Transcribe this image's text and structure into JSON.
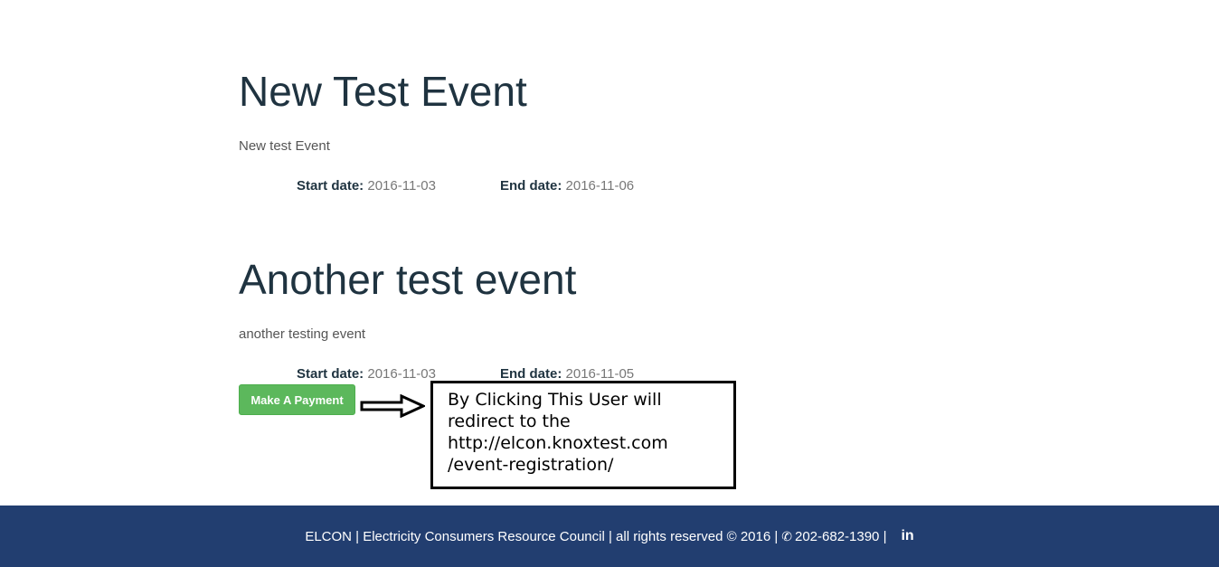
{
  "events": [
    {
      "title": "New Test Event",
      "description": "New test Event",
      "start_label": "Start date:",
      "start_date": "2016-11-03",
      "end_label": "End date:",
      "end_date": "2016-11-06"
    },
    {
      "title": "Another test event",
      "description": "another testing event",
      "start_label": "Start date:",
      "start_date": "2016-11-03",
      "end_label": "End date:",
      "end_date": "2016-11-05",
      "button_label": "Make A Payment"
    }
  ],
  "annotation": {
    "text": "By Clicking This User will\nredirect to the\nhttp://elcon.knoxtest.com\n/event-registration/"
  },
  "footer": {
    "text_before_phone": "ELCON | Electricity Consumers Resource Council | all rights reserved © 2016 |",
    "phone": "202-682-1390 |",
    "linkedin_label": "in"
  },
  "colors": {
    "button": "#5cb85c",
    "footer_bg": "#223e70",
    "title": "#1f3340"
  },
  "icons": [
    "phone-icon",
    "linkedin-icon",
    "arrow-right-icon"
  ]
}
